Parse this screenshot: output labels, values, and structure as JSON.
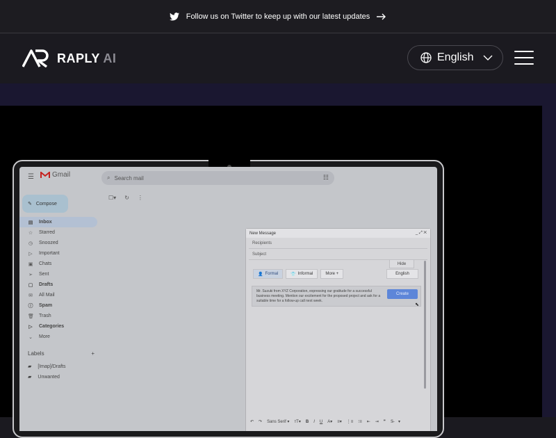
{
  "announcement": {
    "text": "Follow us on Twitter to keep up with our latest updates",
    "icon": "twitter-icon",
    "arrow_icon": "arrow-right-icon"
  },
  "header": {
    "brand_name": "RAPLY",
    "brand_suffix": "AI",
    "language_label": "English",
    "language_icon": "globe-icon",
    "chevron_icon": "chevron-down-icon",
    "menu_icon": "hamburger-icon"
  },
  "gmail": {
    "app_name": "Gmail",
    "search_placeholder": "Search mail",
    "compose_label": "Compose",
    "nav": [
      {
        "label": "Inbox",
        "icon": "inbox-icon",
        "glyph": "▤",
        "active": true,
        "bold": true
      },
      {
        "label": "Starred",
        "icon": "star-icon",
        "glyph": "☆",
        "active": false,
        "bold": false
      },
      {
        "label": "Snoozed",
        "icon": "clock-icon",
        "glyph": "◷",
        "active": false,
        "bold": false
      },
      {
        "label": "Important",
        "icon": "important-icon",
        "glyph": "▷",
        "active": false,
        "bold": false
      },
      {
        "label": "Chats",
        "icon": "chat-icon",
        "glyph": "▣",
        "active": false,
        "bold": false
      },
      {
        "label": "Sent",
        "icon": "send-icon",
        "glyph": "➢",
        "active": false,
        "bold": false
      },
      {
        "label": "Drafts",
        "icon": "draft-icon",
        "glyph": "▢",
        "active": false,
        "bold": true
      },
      {
        "label": "All Mail",
        "icon": "all-mail-icon",
        "glyph": "✉",
        "active": false,
        "bold": false
      },
      {
        "label": "Spam",
        "icon": "spam-icon",
        "glyph": "ⓘ",
        "active": false,
        "bold": true
      },
      {
        "label": "Trash",
        "icon": "trash-icon",
        "glyph": "🗑",
        "active": false,
        "bold": false
      },
      {
        "label": "Categories",
        "icon": "label-icon",
        "glyph": "▷",
        "active": false,
        "bold": true
      },
      {
        "label": "More",
        "icon": "chevron-down-icon",
        "glyph": "⌄",
        "active": false,
        "bold": false
      }
    ],
    "labels_heading": "Labels",
    "labels": [
      {
        "label": "[Imap]/Drafts"
      },
      {
        "label": "Unwanted"
      }
    ],
    "compose_window": {
      "title": "New Message",
      "recipients_placeholder": "Recipients",
      "subject_placeholder": "Subject",
      "hide_label": "Hide",
      "tones": [
        {
          "label": "Formal",
          "glyph": "👤",
          "selected": true
        },
        {
          "label": "Informal",
          "glyph": "👕",
          "selected": false
        },
        {
          "label": "More +",
          "glyph": "",
          "selected": false
        }
      ],
      "language": "English",
      "prompt_text": "Mr. Suzuki from XYZ Corporation, expressing our gratitude for a successful business meeting. Mention our excitement for the proposed project and ask for a suitable time for a follow-up call next week.",
      "create_label": "Create",
      "font_name": "Sans Serif"
    }
  }
}
